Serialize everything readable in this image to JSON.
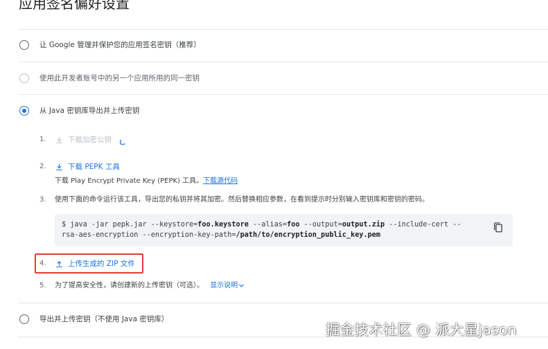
{
  "page": {
    "title": "应用签名偏好设置"
  },
  "options": [
    {
      "label": "让 Google 管理并保护您的应用签名密钥（推荐）",
      "state": "unchecked"
    },
    {
      "label": "使用此开发者账号中的另一个应用所用的同一密钥",
      "state": "disabled"
    },
    {
      "label": "从 Java 密钥库导出并上传密钥",
      "state": "checked"
    },
    {
      "label": "导出并上传密钥（不使用 Java 密钥库）",
      "state": "unchecked"
    }
  ],
  "steps": [
    {
      "num": "1.",
      "label": "下载加密公钥",
      "icon": "download-icon",
      "enabled": false
    },
    {
      "num": "2.",
      "label": "下载 PEPK 工具",
      "icon": "download-icon",
      "enabled": true,
      "desc": "下载 Play Encrypt Private Key (PEPK) 工具。",
      "desc_link": "下载源代码"
    },
    {
      "num": "3.",
      "text": "使用下面的命令运行该工具，导出您的私钥并将其加密。然后替换相应参数，在看到提示时分别输入密钥库和密钥的密码。"
    },
    {
      "num": "4.",
      "label": "上传生成的 ZIP 文件",
      "icon": "upload-icon",
      "enabled": true
    },
    {
      "num": "5.",
      "text": "为了提高安全性，请创建新的上传密钥（可选）。",
      "link": "显示说明",
      "link_icon": "chevron-down-icon"
    }
  ],
  "command": {
    "l1_a": "$ java -jar pepk.jar --keystore=",
    "l1_b": "foo.keystore",
    "l1_c": " --alias=",
    "l1_d": "foo",
    "l1_e": " --output=",
    "l1_f": "output.zip",
    "l1_g": " --include-cert --",
    "l2_a": "rsa-aes-encryption --encryption-key-path=",
    "l2_b": "/path/to/encryption_public_key.pem",
    "copy_icon": "copy-icon"
  },
  "watermark": "掘金技术社区 @ 派大星jason",
  "colors": {
    "accent": "#1a73e8",
    "highlight": "#e53935",
    "codebg": "#f1f3f4"
  }
}
